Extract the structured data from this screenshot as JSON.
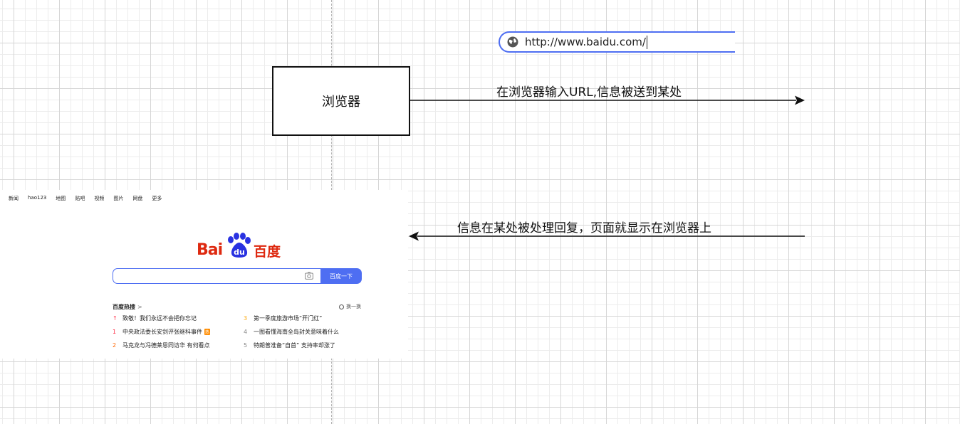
{
  "diagram": {
    "browser_box_label": "浏览器",
    "url_bar_text": "http://www.baidu.com/",
    "arrow_request_label": "在浏览器输入URL,信息被送到某处",
    "arrow_response_label": "信息在某处被处理回复，页面就显示在浏览器上"
  },
  "baidu_page": {
    "nav_links": [
      "新闻",
      "hao123",
      "地图",
      "贴吧",
      "视频",
      "图片",
      "网盘",
      "更多"
    ],
    "logo_latin": "Bai",
    "logo_paw_text": "du",
    "logo_cn": "百度",
    "search_button": "百度一下",
    "hot_title": "百度热搜",
    "hot_chevron": ">",
    "refresh_label": "换一换",
    "hot_items": [
      {
        "rank": "↑",
        "text": "致敬！我们永远不会把你忘记"
      },
      {
        "rank": "1",
        "text": "中央政法委长安剑评张继科事件",
        "badge": "热"
      },
      {
        "rank": "2",
        "text": "马克龙与冯德莱恩同访华 有何看点"
      },
      {
        "rank": "3",
        "text": "第一季度旅游市场“开门红”"
      },
      {
        "rank": "4",
        "text": "一图看懂海南全岛封关意味着什么"
      },
      {
        "rank": "5",
        "text": "特朗普准备“自首” 支持率却涨了"
      }
    ]
  },
  "colors": {
    "arrow": "#111111",
    "baidu_blue": "#4e6ef2",
    "baidu_red": "#de2910",
    "grid": "#d6d6d6"
  }
}
